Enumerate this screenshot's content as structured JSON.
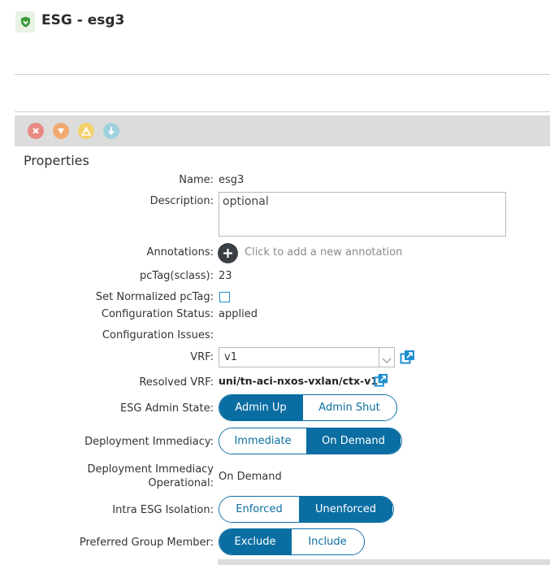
{
  "header": {
    "title": "ESG - esg3",
    "shield_icon": "shield-icon",
    "shield_color": "#3c9a3c"
  },
  "toolbar": {
    "faults": [
      {
        "name": "critical-fault-icon",
        "color": "#e88a82"
      },
      {
        "name": "major-fault-icon",
        "color": "#f2a970"
      },
      {
        "name": "minor-fault-icon",
        "color": "#f3d06a"
      },
      {
        "name": "warning-fault-icon",
        "color": "#9fd2dc"
      }
    ]
  },
  "properties": {
    "section_title": "Properties",
    "name": {
      "label": "Name:",
      "value": "esg3"
    },
    "description": {
      "label": "Description:",
      "placeholder": "optional"
    },
    "annotations": {
      "label": "Annotations:",
      "hint": "Click to add a new annotation"
    },
    "pctag": {
      "label": "pcTag(sclass):",
      "value": "23"
    },
    "normalized_pctag": {
      "label": "Set Normalized pcTag:",
      "checked": false
    },
    "config_status": {
      "label": "Configuration Status:",
      "value": "applied"
    },
    "config_issues": {
      "label": "Configuration Issues:",
      "value": ""
    },
    "vrf": {
      "label": "VRF:",
      "value": "v1"
    },
    "resolved_vrf": {
      "label": "Resolved VRF:",
      "value": "uni/tn-aci-nxos-vxlan/ctx-v1"
    },
    "admin_state": {
      "label": "ESG Admin State:",
      "options": [
        "Admin Up",
        "Admin Shut"
      ],
      "selected": "Admin Up"
    },
    "deploy_immediacy": {
      "label": "Deployment Immediacy:",
      "options": [
        "Immediate",
        "On Demand"
      ],
      "selected": "On Demand"
    },
    "deploy_operational": {
      "label_line1": "Deployment Immediacy",
      "label_line2": "Operational:",
      "value": "On Demand"
    },
    "isolation": {
      "label": "Intra ESG Isolation:",
      "options": [
        "Enforced",
        "Unenforced"
      ],
      "selected": "Unenforced"
    },
    "preferred_group": {
      "label": "Preferred Group Member:",
      "options": [
        "Exclude",
        "Include"
      ],
      "selected": "Exclude"
    }
  },
  "colors": {
    "accent": "#0b6ea3",
    "checkbox": "#1d8ecf",
    "toolbar_bg": "#dcdcdc"
  }
}
